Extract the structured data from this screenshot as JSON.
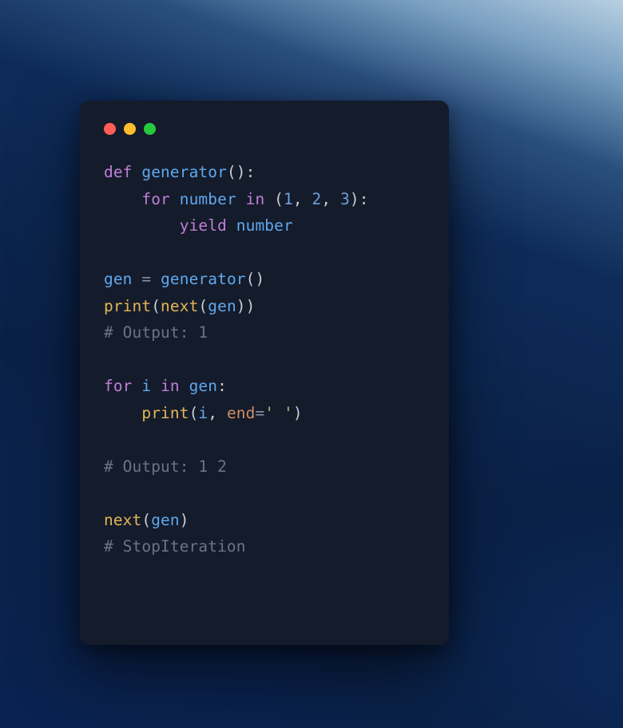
{
  "traffic_lights": {
    "red": "close",
    "yellow": "minimize",
    "green": "zoom"
  },
  "code": {
    "l1": {
      "kw_def": "def",
      "sp": " ",
      "fn": "generator",
      "paren": "():"
    },
    "l2": {
      "indent": "    ",
      "kw_for": "for",
      "sp1": " ",
      "var": "number",
      "sp2": " ",
      "kw_in": "in",
      "sp3": " ",
      "open": "(",
      "n1": "1",
      "c1": ", ",
      "n2": "2",
      "c2": ", ",
      "n3": "3",
      "close": "):"
    },
    "l3": {
      "indent": "        ",
      "kw_yield": "yield",
      "sp": " ",
      "var": "number"
    },
    "l4": "",
    "l5": {
      "var": "gen",
      "sp1": " ",
      "eq": "=",
      "sp2": " ",
      "fn": "generator",
      "paren": "()"
    },
    "l6": {
      "fn_print": "print",
      "open": "(",
      "fn_next": "next",
      "open2": "(",
      "var": "gen",
      "close": "))"
    },
    "l7": {
      "cmt": "# Output: 1"
    },
    "l8": "",
    "l9": {
      "kw_for": "for",
      "sp1": " ",
      "var": "i",
      "sp2": " ",
      "kw_in": "in",
      "sp3": " ",
      "var2": "gen",
      "colon": ":"
    },
    "l10": {
      "indent": "    ",
      "fn_print": "print",
      "open": "(",
      "var": "i",
      "comma": ", ",
      "arg": "end",
      "eq": "=",
      "str": "' '",
      "close": ")"
    },
    "l11": "",
    "l12": {
      "cmt": "# Output: 1 2"
    },
    "l13": "",
    "l14": {
      "fn_next": "next",
      "open": "(",
      "var": "gen",
      "close": ")"
    },
    "l15": {
      "cmt": "# StopIteration"
    }
  }
}
